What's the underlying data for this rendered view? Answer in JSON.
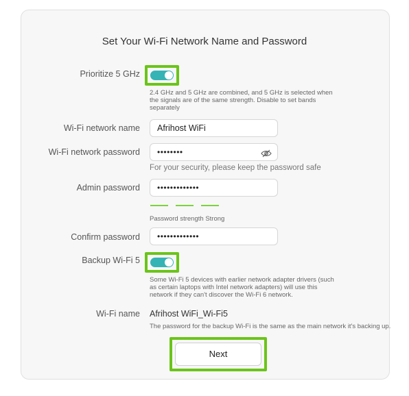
{
  "title": "Set Your Wi-Fi Network Name and Password",
  "prioritize": {
    "label": "Prioritize 5 GHz",
    "enabled": true,
    "hint_lines": [
      "2.4 GHz and 5 GHz are combined, and 5 GHz is selected when",
      "the signals are of the same strength. Disable to set bands",
      "separately"
    ]
  },
  "wifi_name": {
    "label": "Wi-Fi network name",
    "value": "Afrihost WiFi"
  },
  "wifi_password": {
    "label": "Wi-Fi network password",
    "value": "••••••••",
    "hint": "For your security, please keep the password safe"
  },
  "admin_password": {
    "label": "Admin password",
    "value": "•••••••••••••",
    "strength_text": "Password strength Strong",
    "strength_level": 3
  },
  "confirm_password": {
    "label": "Confirm password",
    "value": "•••••••••••••"
  },
  "backup": {
    "label": "Backup Wi-Fi 5",
    "enabled": true,
    "hint_lines": [
      "Some Wi-Fi 5 devices with earlier network adapter drivers (such",
      "as certain laptops with Intel network adapters) will use this",
      "network if they can't discover the Wi-Fi 6 network."
    ]
  },
  "backup_name": {
    "label": "Wi-Fi name",
    "value": "Afrihost WiFi_Wi-Fi5",
    "hint": "The password for the backup Wi-Fi is the same as the main network it's backing up."
  },
  "next_label": "Next",
  "colors": {
    "toggle_on": "#36b3b4",
    "highlight": "#6bc41a",
    "strength": "#7dd23c"
  },
  "icons": {
    "eye": "eye-slash-icon"
  }
}
